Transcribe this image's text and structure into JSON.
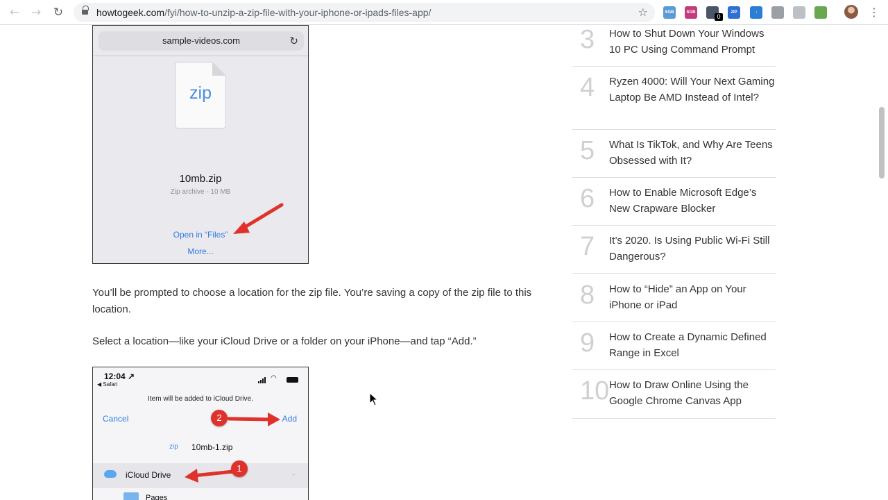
{
  "browser": {
    "back_icon": "←",
    "forward_icon": "→",
    "reload_icon": "↻",
    "url_host": "howtogeek.com",
    "url_path": "/fyi/how-to-unzip-a-zip-file-with-your-iphone-or-ipads-files-app/",
    "star_icon": "☆",
    "extensions": [
      {
        "label": "SGB",
        "color": "#5b9bd5"
      },
      {
        "label": "SGB",
        "color": "#c53a7a"
      },
      {
        "label": "",
        "color": "#4a5568"
      },
      {
        "label": "ZIP",
        "color": "#2f6fd1"
      },
      {
        "label": "↓",
        "color": "#2a7fd4"
      },
      {
        "label": "",
        "color": "#9aa0a6"
      },
      {
        "label": "",
        "color": "#bdc1c6"
      },
      {
        "label": "",
        "color": "#6aa84f"
      }
    ],
    "extension_badge": "0",
    "menu_icon": "⋮"
  },
  "article": {
    "shot1": {
      "address": "sample-videos.com",
      "reload_icon": "↻",
      "zip_label": "zip",
      "file_name": "10mb.zip",
      "file_meta": "Zip archive - 10 MB",
      "open_link": "Open in “Files”",
      "more_link": "More..."
    },
    "paragraph1": "You’ll be prompted to choose a location for the zip file. You’re saving a copy of the zip file to this location.",
    "paragraph2": "Select a location—like your iCloud Drive or a folder on your iPhone—and tap “Add.”",
    "shot2": {
      "time": "12:04 ↗",
      "back": "◀ Safari",
      "info": "Item will be added to iCloud Drive.",
      "cancel": "Cancel",
      "add": "Add",
      "zip_label": "zip",
      "file_name": "10mb-1.zip",
      "location": "iCloud Drive",
      "chevron": "⌄",
      "folder": "Pages",
      "badge1": "1",
      "badge2": "2"
    }
  },
  "sidebar": {
    "items": [
      {
        "num": "3",
        "title": "How to Shut Down Your Windows 10 PC Using Command Prompt"
      },
      {
        "num": "4",
        "title": "Ryzen 4000: Will Your Next Gaming Laptop Be AMD Instead of Intel?"
      },
      {
        "num": "5",
        "title": "What Is TikTok, and Why Are Teens Obsessed with It?"
      },
      {
        "num": "6",
        "title": "How to Enable Microsoft Edge’s New Crapware Blocker"
      },
      {
        "num": "7",
        "title": "It’s 2020. Is Using Public Wi-Fi Still Dangerous?"
      },
      {
        "num": "8",
        "title": "How to “Hide” an App on Your iPhone or iPad"
      },
      {
        "num": "9",
        "title": "How to Create a Dynamic Defined Range in Excel"
      },
      {
        "num": "10",
        "title": "How to Draw Online Using the Google Chrome Canvas App"
      }
    ]
  },
  "colors": {
    "link_blue": "#2f7ce0",
    "arrow_red": "#e0322c",
    "badge_red": "#e0322c"
  }
}
